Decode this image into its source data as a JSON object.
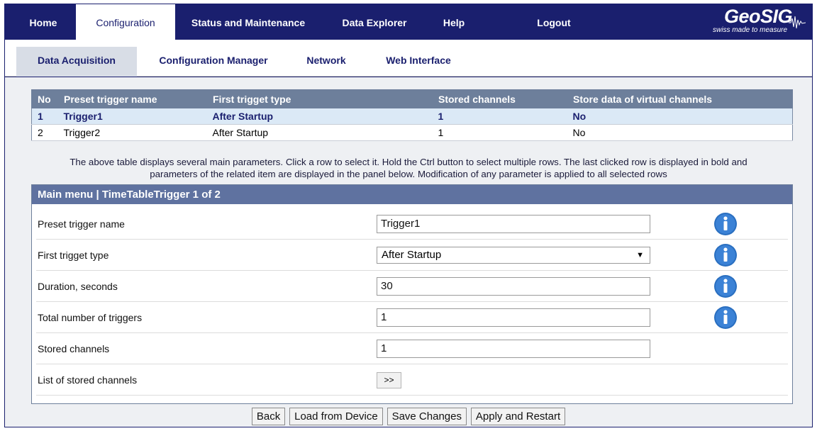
{
  "topnav": {
    "items": [
      "Home",
      "Configuration",
      "Status and Maintenance",
      "Data Explorer",
      "Help",
      "Logout"
    ],
    "active": "Configuration"
  },
  "logo": {
    "brand": "GeoSIG",
    "tagline": "swiss made to measure"
  },
  "subnav": {
    "items": [
      "Data Acquisition",
      "Configuration Manager",
      "Network",
      "Web Interface"
    ],
    "active": "Data Acquisition"
  },
  "table": {
    "headers": [
      "No",
      "Preset trigger name",
      "First trigget type",
      "Stored channels",
      "Store data of virtual channels"
    ],
    "rows": [
      [
        "1",
        "Trigger1",
        "After Startup",
        "1",
        "No"
      ],
      [
        "2",
        "Trigger2",
        "After Startup",
        "1",
        "No"
      ]
    ],
    "selected_row": 1
  },
  "help_text": {
    "line1": "The above table displays several main parameters. Click a row to select it. Hold the Ctrl button to select multiple rows. The last clicked row is displayed in bold and",
    "line2": "parameters of the related item are displayed in the panel below. Modification of any parameter is applied to all selected rows"
  },
  "panel": {
    "title": "Main menu | TimeTableTrigger 1 of 2",
    "fields": [
      {
        "label": "Preset trigger name",
        "value": "Trigger1"
      },
      {
        "label": "First trigget type",
        "value": "After Startup"
      },
      {
        "label": "Duration, seconds",
        "value": "30"
      },
      {
        "label": "Total number of triggers",
        "value": "1"
      },
      {
        "label": "Stored channels",
        "value": "1"
      },
      {
        "label": "List of stored channels",
        "button": ">>"
      }
    ]
  },
  "buttons": [
    "Back",
    "Load from Device",
    "Save Changes",
    "Apply and Restart"
  ],
  "colors": {
    "nav_bg": "#1a1f6e",
    "table_header": "#6d7f9b",
    "selected_row": "#dbe9f6",
    "info_icon": "#2a6fc0"
  }
}
